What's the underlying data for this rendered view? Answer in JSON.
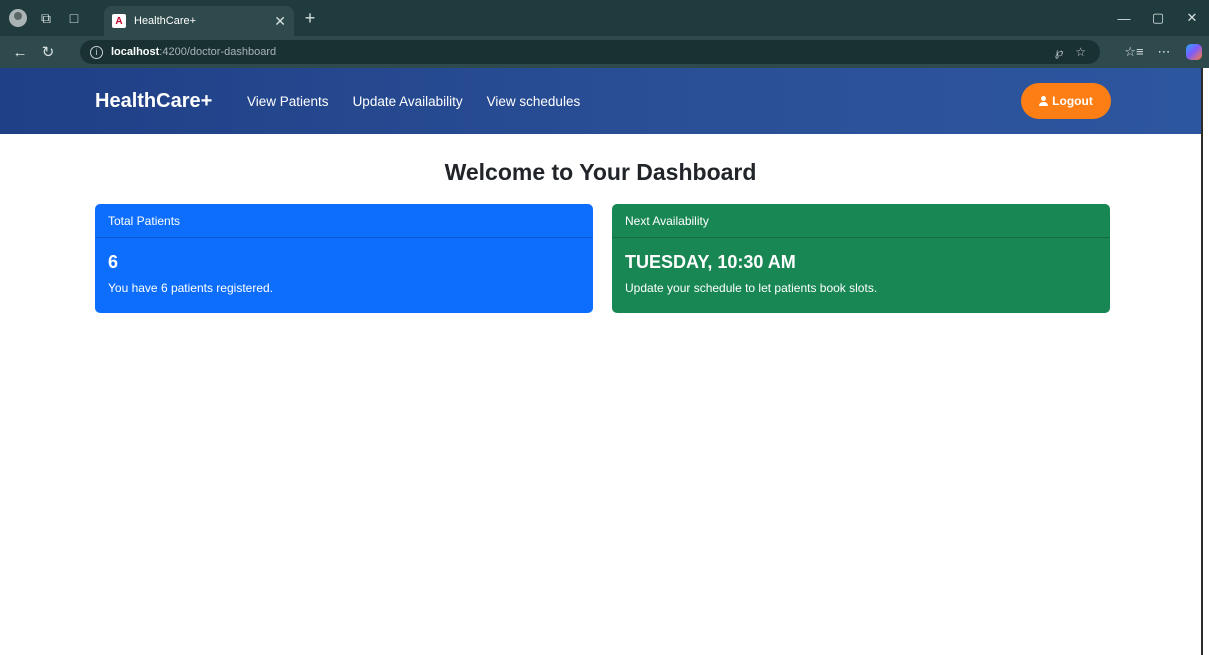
{
  "browser": {
    "tab_title": "HealthCare+",
    "tab_favicon_letter": "A",
    "new_tab_icon": "+",
    "url_host": "localhost",
    "url_rest": ":4200/doctor-dashboard"
  },
  "navbar": {
    "brand": "HealthCare+",
    "links": [
      "View Patients",
      "Update Availability",
      "View schedules"
    ],
    "logout_label": "Logout"
  },
  "main": {
    "title": "Welcome to Your Dashboard",
    "cards": [
      {
        "header": "Total Patients",
        "value": "6",
        "text": "You have 6 patients registered.",
        "color": "#0d6efd"
      },
      {
        "header": "Next Availability",
        "value": "TUESDAY, 10:30 AM",
        "text": "Update your schedule to let patients book slots.",
        "color": "#198754"
      }
    ]
  },
  "colors": {
    "navbar": "#2a4f96",
    "logout": "#fd7e14",
    "browser_frame": "#1f3b3d"
  }
}
